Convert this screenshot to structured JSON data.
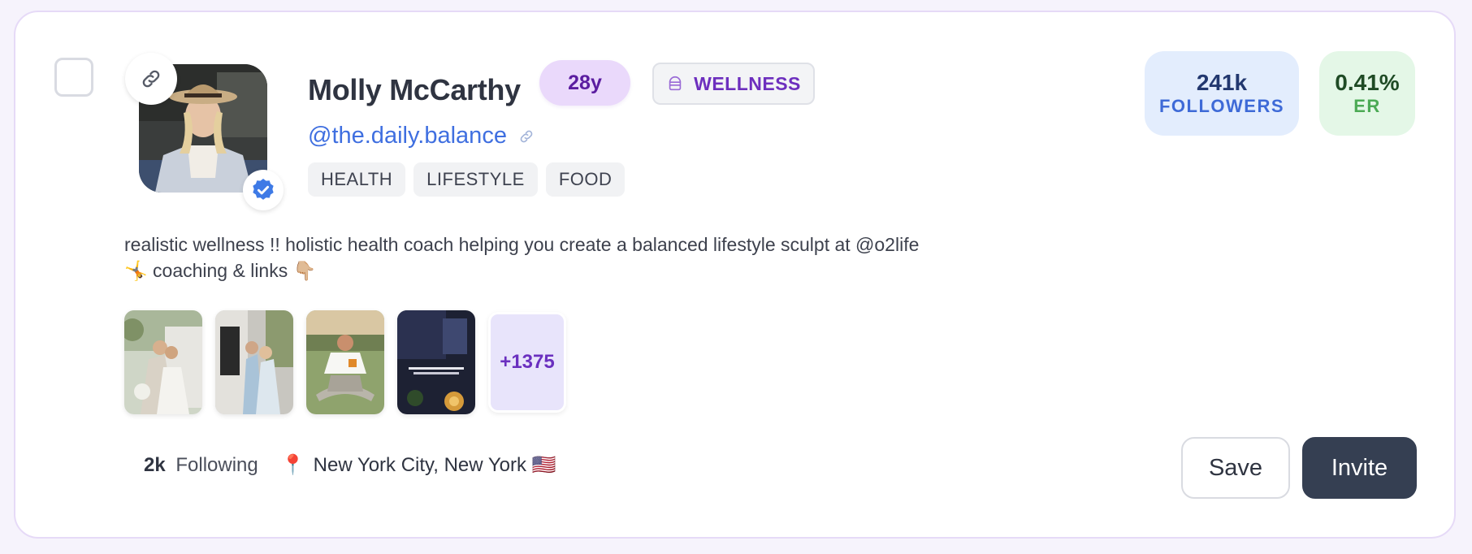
{
  "profile": {
    "name": "Molly McCarthy",
    "age": "28y",
    "niche": "WELLNESS",
    "handle": "@the.daily.balance",
    "tags": [
      "HEALTH",
      "LIFESTYLE",
      "FOOD"
    ],
    "bio": "realistic wellness !! holistic health coach helping you create a balanced lifestyle sculpt at @o2life 🤸 coaching & links 👇🏼",
    "verified": true
  },
  "stats": {
    "followers_value": "241k",
    "followers_label": "FOLLOWERS",
    "er_value": "0.41%",
    "er_label": "ER"
  },
  "media": {
    "thumbnails": [
      "wedding-photo",
      "couple-photo",
      "meditation-photo",
      "evening-drink-photo"
    ],
    "more_count": "+1375"
  },
  "meta": {
    "following_count": "2k",
    "following_label": "Following",
    "location_icon": "📍",
    "location": "New York City, New York 🇺🇸"
  },
  "actions": {
    "save_label": "Save",
    "invite_label": "Invite"
  },
  "colors": {
    "card_border": "#e6daf7",
    "age_pill_bg": "#ead9fb",
    "niche_text": "#6d2fbe",
    "handle": "#3f6fe0",
    "followers_bg": "#e3edfd",
    "er_bg": "#e4f7e7",
    "invite_bg": "#353f52",
    "verified": "#3e7ae6"
  }
}
